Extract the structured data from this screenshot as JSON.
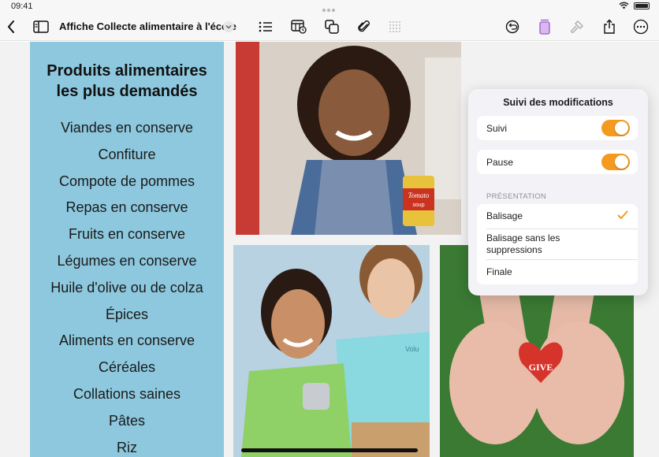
{
  "status": {
    "time": "09:41"
  },
  "toolbar": {
    "doc_title": "Affiche Collecte alimentaire à l'école"
  },
  "poster": {
    "title_line1": "Produits alimentaires",
    "title_line2": "les plus demandés",
    "items": [
      "Viandes en conserve",
      "Confiture",
      "Compote de pommes",
      "Repas en conserve",
      "Fruits en conserve",
      "Légumes en conserve",
      "Huile d'olive ou de colza",
      "Épices",
      "Aliments en conserve",
      "Céréales",
      "Collations saines",
      "Pâtes",
      "Riz"
    ],
    "can_label_1": "Tomato",
    "can_label_2": "soup",
    "shirt_text": "Volu",
    "heart_text": "GIVE"
  },
  "popover": {
    "title": "Suivi des modifications",
    "tracking_label": "Suivi",
    "tracking_on": true,
    "pause_label": "Pause",
    "pause_on": true,
    "section_header": "PRÉSENTATION",
    "options": [
      {
        "label": "Balisage",
        "selected": true
      },
      {
        "label": "Balisage sans les suppressions",
        "selected": false
      },
      {
        "label": "Finale",
        "selected": false
      }
    ]
  },
  "colors": {
    "accent": "#f39a1f",
    "panel_blue": "#8dc8de",
    "heart_red": "#d6332a"
  }
}
